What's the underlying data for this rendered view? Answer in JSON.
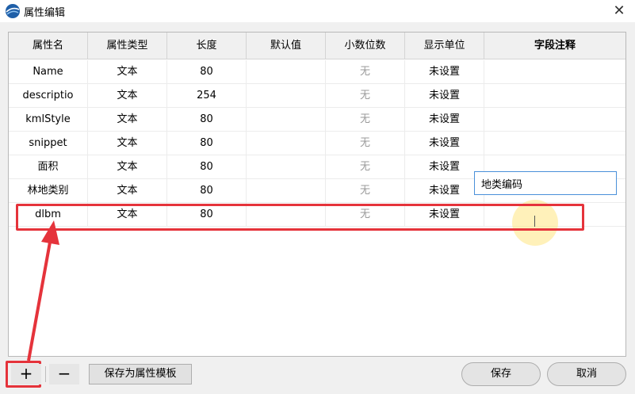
{
  "window": {
    "title": "属性编辑",
    "close_glyph": "✕"
  },
  "table": {
    "columns": [
      "属性名",
      "属性类型",
      "长度",
      "默认值",
      "小数位数",
      "显示单位",
      "字段注释"
    ],
    "rows": [
      {
        "name": "Name",
        "type": "文本",
        "length": "80",
        "default": "",
        "decimals": "无",
        "unit": "未设置",
        "comment": ""
      },
      {
        "name": "descriptio",
        "type": "文本",
        "length": "254",
        "default": "",
        "decimals": "无",
        "unit": "未设置",
        "comment": ""
      },
      {
        "name": "kmlStyle",
        "type": "文本",
        "length": "80",
        "default": "",
        "decimals": "无",
        "unit": "未设置",
        "comment": ""
      },
      {
        "name": "snippet",
        "type": "文本",
        "length": "80",
        "default": "",
        "decimals": "无",
        "unit": "未设置",
        "comment": ""
      },
      {
        "name": "面积",
        "type": "文本",
        "length": "80",
        "default": "",
        "decimals": "无",
        "unit": "未设置",
        "comment": ""
      },
      {
        "name": "林地类别",
        "type": "文本",
        "length": "80",
        "default": "",
        "decimals": "无",
        "unit": "未设置",
        "comment": ""
      },
      {
        "name": "dlbm",
        "type": "文本",
        "length": "80",
        "default": "",
        "decimals": "无",
        "unit": "未设置",
        "comment": ""
      }
    ],
    "editing_comment_value": "地类编码"
  },
  "footer": {
    "add_label": "+",
    "remove_label": "−",
    "save_template_label": "保存为属性模板",
    "save_label": "保存",
    "cancel_label": "取消"
  },
  "colors": {
    "annotation_red": "#e5333b",
    "input_focus": "#4a90d9",
    "header_bg": "#f0f0f0"
  },
  "icons": {
    "app": "globe-logo-icon",
    "close": "close-icon"
  }
}
